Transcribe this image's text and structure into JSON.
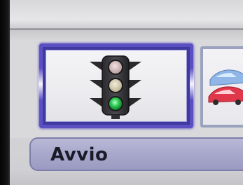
{
  "menu": {
    "items": [
      {
        "icon": "traffic-light-icon",
        "selected": true
      },
      {
        "icon": "cars-icon",
        "selected": false
      }
    ],
    "selected_label": "Avvio"
  },
  "colors": {
    "selection_border": "#5b4fc2",
    "label_bar": "#a9a9cc",
    "traffic_light_green": "#2ecc55"
  }
}
